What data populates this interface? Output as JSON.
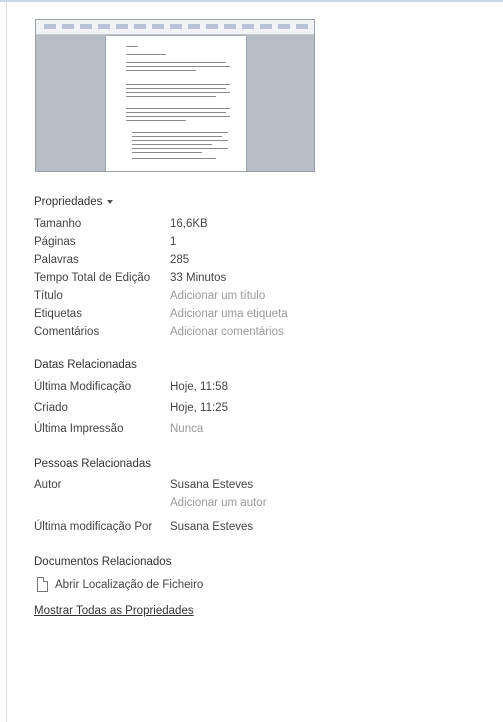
{
  "properties": {
    "heading": "Propriedades",
    "rows": [
      {
        "key": "Tamanho",
        "value": "16,6KB"
      },
      {
        "key": "Páginas",
        "value": "1"
      },
      {
        "key": "Palavras",
        "value": "285"
      },
      {
        "key": "Tempo Total de Edição",
        "value": "33 Minutos"
      },
      {
        "key": "Título",
        "value": "Adicionar um título"
      },
      {
        "key": "Etiquetas",
        "value": "Adicionar uma etiqueta"
      },
      {
        "key": "Comentários",
        "value": "Adicionar comentários"
      }
    ]
  },
  "dates": {
    "heading": "Datas Relacionadas",
    "rows": [
      {
        "key": "Última Modificação",
        "value": "Hoje, 11:58"
      },
      {
        "key": "Criado",
        "value": "Hoje, 11:25"
      },
      {
        "key": "Última Impressão",
        "value": "Nunca"
      }
    ]
  },
  "people": {
    "heading": "Pessoas Relacionadas",
    "author_label": "Autor",
    "author_value": "Susana Esteves",
    "add_author": "Adicionar um autor",
    "last_modified_by_label": "Última modificação Por",
    "last_modified_by_value": "Susana Esteves"
  },
  "documents": {
    "heading": "Documentos Relacionados",
    "open_location": "Abrir Localização de Ficheiro"
  },
  "show_all": "Mostrar Todas as Propriedades",
  "colors": {
    "placeholder": "#9a9a9a",
    "text": "#444444"
  },
  "icons": {
    "properties_menu": "caret-down-icon",
    "file": "document-icon"
  }
}
